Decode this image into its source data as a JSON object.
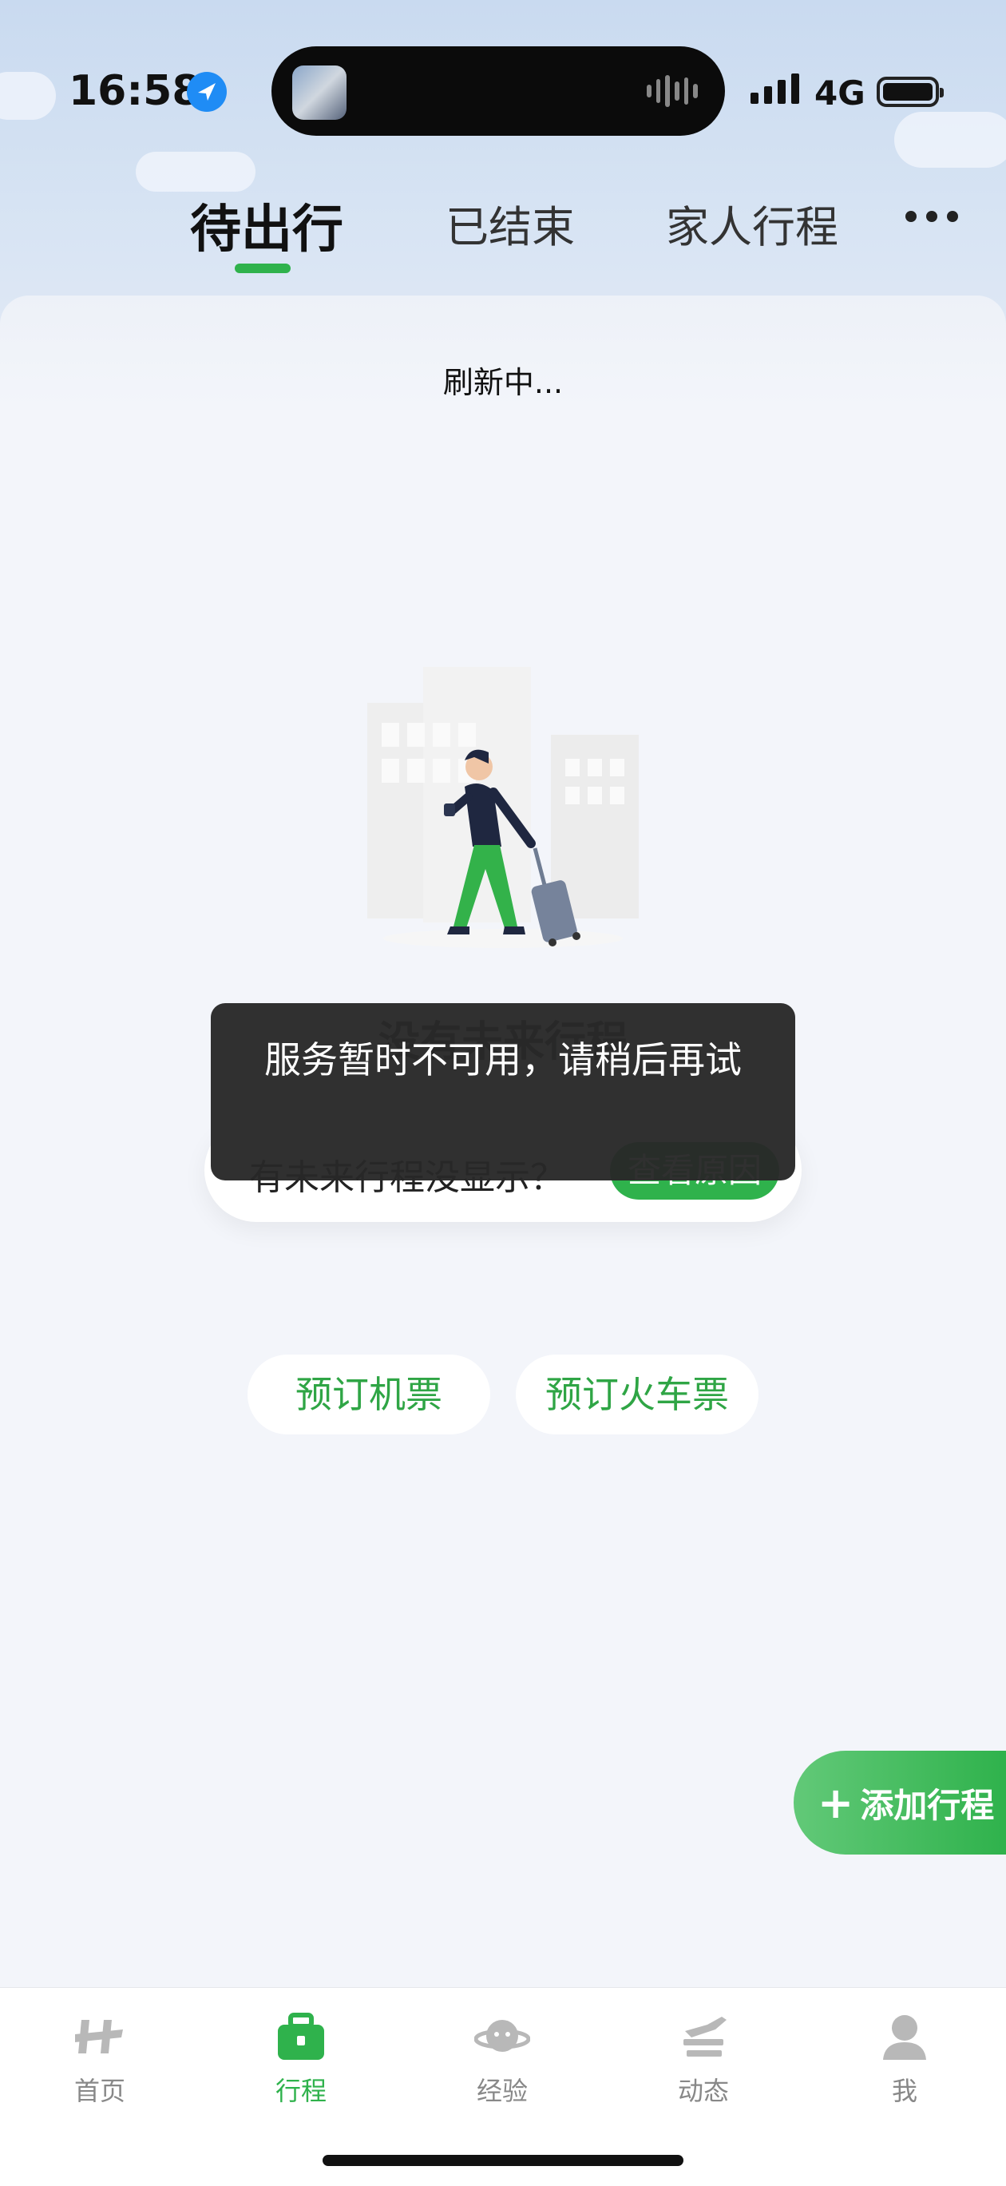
{
  "status_bar": {
    "time": "16:58",
    "network": "4G"
  },
  "tabs": [
    {
      "label": "待出行",
      "active": true
    },
    {
      "label": "已结束",
      "active": false
    },
    {
      "label": "家人行程",
      "active": false
    }
  ],
  "refresh_text": "刷新中...",
  "empty_state": {
    "title": "没有未来行程",
    "hint": "有未来行程没显示？",
    "hint_button": "查看原因"
  },
  "toast": {
    "message": "服务暂时不可用，请稍后再试"
  },
  "actions": {
    "book_flight": "预订机票",
    "book_train": "预订火车票"
  },
  "fab": {
    "label": "添加行程"
  },
  "bottom_nav": [
    {
      "label": "首页",
      "icon": "home-icon",
      "active": false
    },
    {
      "label": "行程",
      "icon": "suitcase-icon",
      "active": true
    },
    {
      "label": "经验",
      "icon": "planet-icon",
      "active": false
    },
    {
      "label": "动态",
      "icon": "flight-status-icon",
      "active": false
    },
    {
      "label": "我",
      "icon": "user-icon",
      "active": false
    }
  ],
  "colors": {
    "accent": "#2fb24c",
    "inactive": "#888888",
    "toast_bg": "#282828"
  }
}
